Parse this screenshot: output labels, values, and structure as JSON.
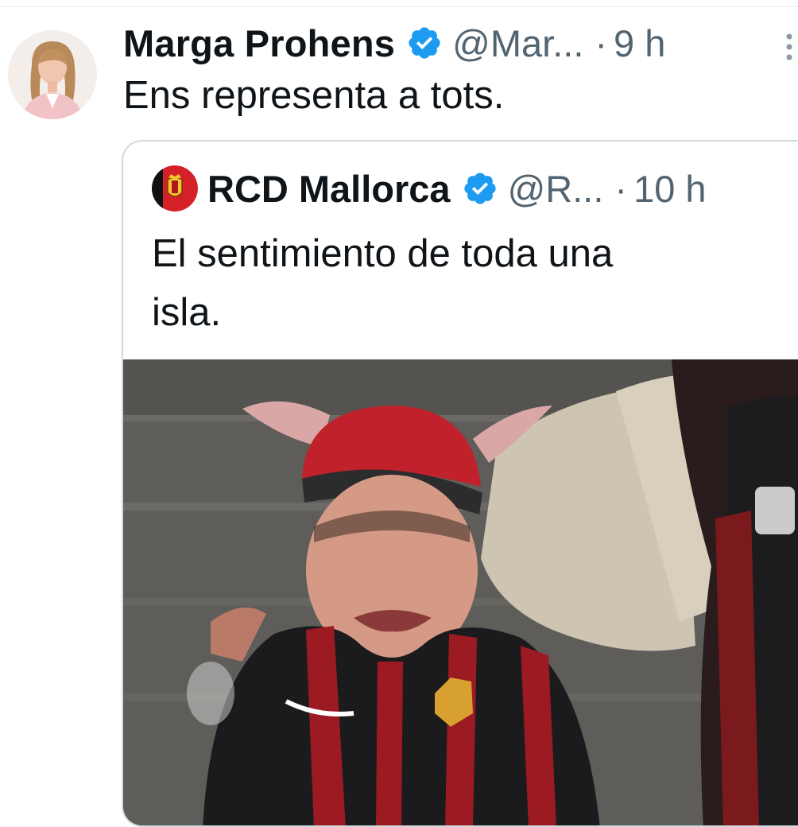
{
  "tweet": {
    "author_name": "Marga Prohens",
    "handle": "@Mar...",
    "separator": "·",
    "time": "9 h",
    "text": "Ens representa a tots.",
    "avatar_icon": "person-avatar-icon",
    "verified_icon": "verified-badge-icon",
    "more_icon": "more-options-icon"
  },
  "quoted_tweet": {
    "author_name": "RCD Mallorca",
    "handle": "@R...",
    "separator": "·",
    "time": "10 h",
    "text_line1": "El sentimiento de toda una",
    "text_line2": "isla.",
    "avatar_icon": "club-crest-icon",
    "verified_icon": "verified-badge-icon",
    "media": {
      "type": "video-frame",
      "description_icon": "media-preview"
    }
  },
  "colors": {
    "verified_blue": "#1d9bf0",
    "text_primary": "#0f1419",
    "text_secondary": "#536471",
    "border": "#cfd9de"
  }
}
